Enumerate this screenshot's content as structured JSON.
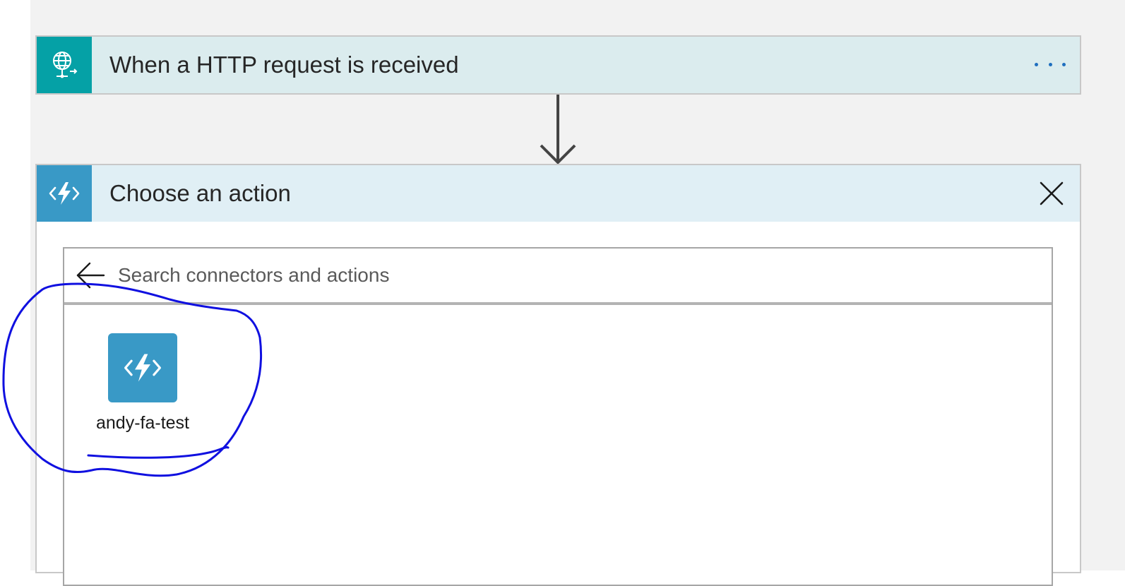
{
  "trigger": {
    "title": "When a HTTP request is received",
    "icon": "globe-request-icon",
    "more_icon": "more-horizontal-icon",
    "accent_color": "#05a1a6",
    "header_color": "#dbecee"
  },
  "flow_connector": {
    "icon": "arrow-down-icon"
  },
  "action_panel": {
    "title": "Choose an action",
    "icon": "azure-function-icon",
    "close_icon": "close-icon",
    "accent_color": "#3999c6",
    "header_color": "#e0eff5"
  },
  "search": {
    "back_icon": "arrow-left-icon",
    "placeholder": "Search connectors and actions",
    "value": ""
  },
  "results": [
    {
      "label": "andy-fa-test",
      "icon": "azure-function-icon",
      "color": "#3999c6"
    }
  ],
  "annotation": {
    "color": "#1010e0",
    "kind": "hand-drawn-circle"
  }
}
